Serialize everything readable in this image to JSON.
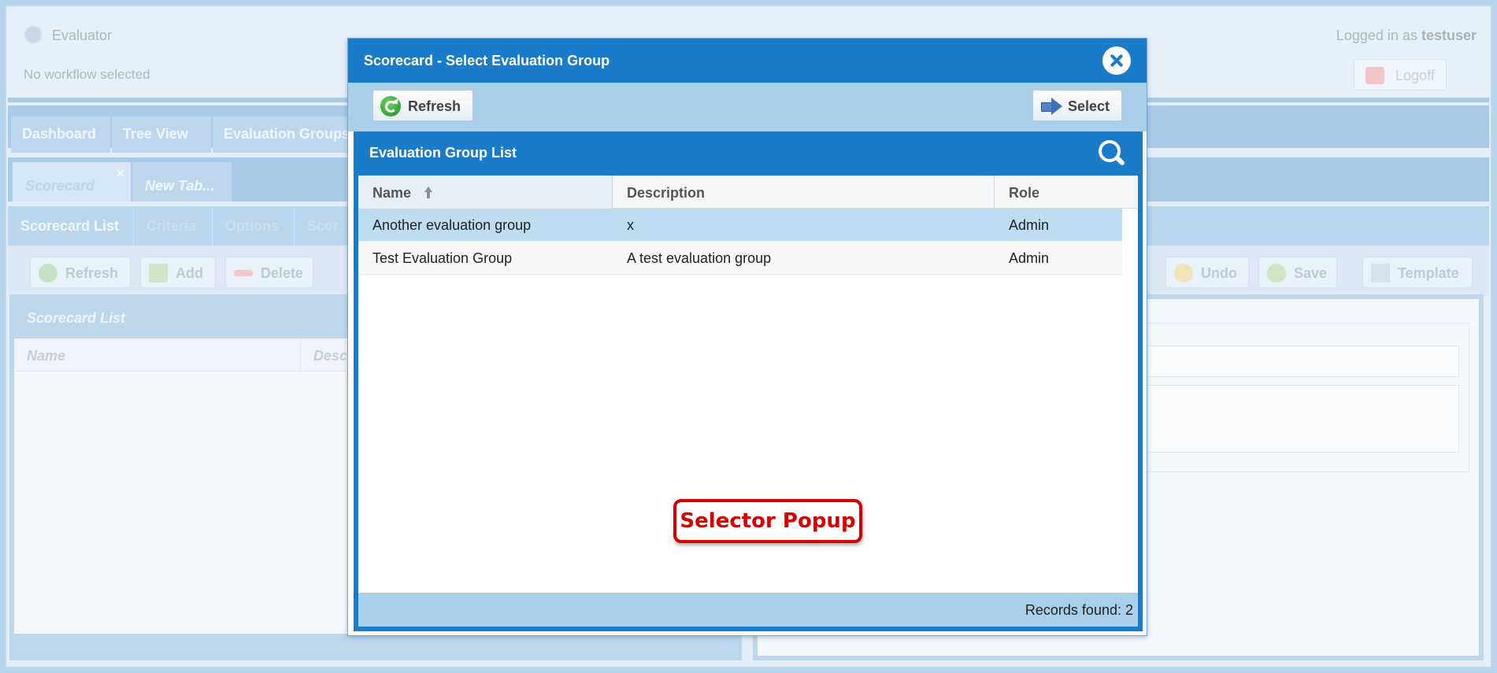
{
  "app": {
    "title": "Evaluator",
    "workflow": "No workflow selected",
    "login_prefix": "Logged in as",
    "username": "testuser",
    "logoff_label": "Logoff"
  },
  "main_tabs": [
    {
      "label": "Dashboard"
    },
    {
      "label": "Tree View"
    },
    {
      "label": "Evaluation Groups"
    }
  ],
  "sub_tabs": {
    "active": "Scorecard",
    "close": "×",
    "new": "New Tab..."
  },
  "nav_tabs": [
    {
      "label": "Scorecard List"
    },
    {
      "label": "Criteria"
    },
    {
      "label": "Options"
    },
    {
      "label": "Scor"
    }
  ],
  "toolbar": {
    "refresh": "Refresh",
    "add": "Add",
    "delete": "Delete",
    "undo": "Undo",
    "save": "Save",
    "template": "Template"
  },
  "left_panel": {
    "title": "Scorecard List",
    "col_name": "Name",
    "col_desc": "Descri"
  },
  "modal": {
    "title": "Scorecard - Select Evaluation Group",
    "refresh_label": "Refresh",
    "select_label": "Select",
    "grid_title": "Evaluation Group List",
    "columns": {
      "name": "Name",
      "description": "Description",
      "role": "Role"
    },
    "rows": [
      {
        "name": "Another evaluation group",
        "description": "x",
        "role": "Admin",
        "selected": true
      },
      {
        "name": "Test Evaluation Group",
        "description": "A test evaluation group",
        "role": "Admin",
        "selected": false
      }
    ],
    "records_found": "Records found: 2"
  },
  "annotation": "Selector Popup",
  "colors": {
    "modal_header": "#1a7cc9",
    "toolbar": "#aacfea",
    "selected_row": "#bedcf2",
    "annotation": "#d60000"
  },
  "icons": [
    "globe-icon",
    "power-icon",
    "close-icon",
    "refresh-icon",
    "select-arrow-icon",
    "search-icon",
    "sort-up-icon",
    "add-icon",
    "delete-icon",
    "undo-icon",
    "save-icon",
    "template-icon"
  ]
}
